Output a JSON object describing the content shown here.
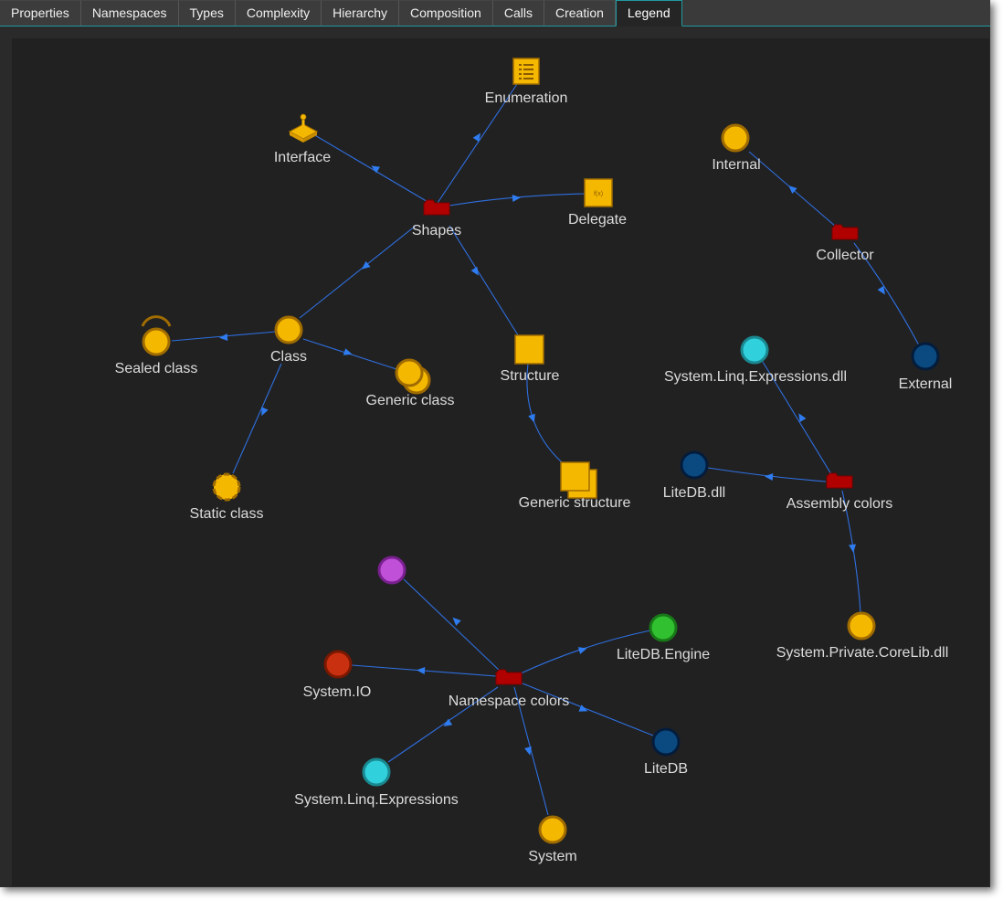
{
  "tabs": [
    {
      "label": "Properties"
    },
    {
      "label": "Namespaces"
    },
    {
      "label": "Types"
    },
    {
      "label": "Complexity"
    },
    {
      "label": "Hierarchy"
    },
    {
      "label": "Composition"
    },
    {
      "label": "Calls"
    },
    {
      "label": "Creation"
    },
    {
      "label": "Legend"
    }
  ],
  "active_tab": "Legend",
  "colors": {
    "class_fill": "#f5b800",
    "class_stroke": "#9c6a00",
    "folder": "#b00000",
    "edge": "#2f6fe0",
    "external": "#0a4a80",
    "linq": "#30d0dc",
    "engine": "#30c030",
    "systemio": "#c83010",
    "purple": "#c050d8"
  },
  "legend": {
    "shapes": {
      "hub": "Shapes",
      "enumeration": "Enumeration",
      "interface": "Interface",
      "delegate": "Delegate",
      "class": "Class",
      "sealed_class": "Sealed class",
      "generic_class": "Generic class",
      "static_class": "Static class",
      "structure": "Structure",
      "generic_structure": "Generic structure"
    },
    "collector": {
      "hub": "Collector",
      "internal": "Internal",
      "external": "External"
    },
    "assembly_colors": {
      "hub": "Assembly colors",
      "linq_dll": "System.Linq.Expressions.dll",
      "litedb_dll": "LiteDB.dll",
      "corelib_dll": "System.Private.CoreLib.dll"
    },
    "namespace_colors": {
      "hub": "Namespace colors",
      "litedb_engine": "LiteDB.Engine",
      "system_io": "System.IO",
      "litedb": "LiteDB",
      "linq": "System.Linq.Expressions",
      "system": "System"
    }
  }
}
